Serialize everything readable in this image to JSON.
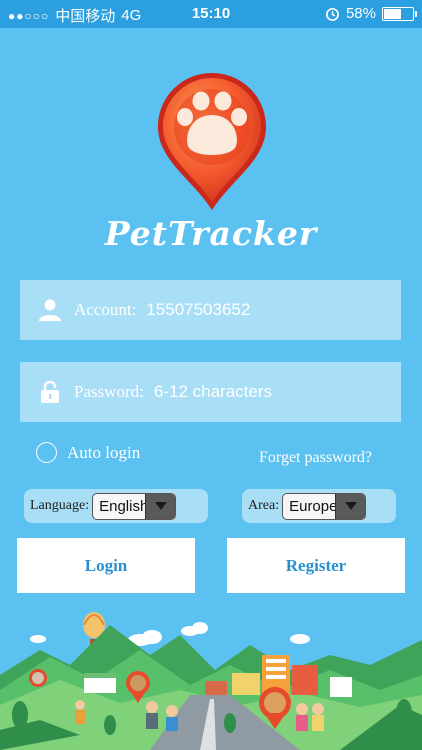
{
  "status_bar": {
    "signal": "●●○○○",
    "carrier": "中国移动",
    "network": "4G",
    "time": "15:10",
    "battery_percent": "58%",
    "battery_level": 0.58
  },
  "app": {
    "name": "PetTracker"
  },
  "account": {
    "label": "Account:",
    "value": "15507503652"
  },
  "password": {
    "label": "Password:",
    "placeholder": "6-12 characters"
  },
  "auto_login": {
    "label": "Auto login"
  },
  "forget_password": {
    "label": "Forget password?"
  },
  "language": {
    "label": "Language:",
    "value": "English"
  },
  "area": {
    "label": "Area:",
    "value": "Europe"
  },
  "buttons": {
    "login": "Login",
    "register": "Register"
  },
  "colors": {
    "background": "#5bc1f0",
    "field": "#a8def6",
    "button_text": "#2a8fd0",
    "pin": "#e84a2c"
  }
}
